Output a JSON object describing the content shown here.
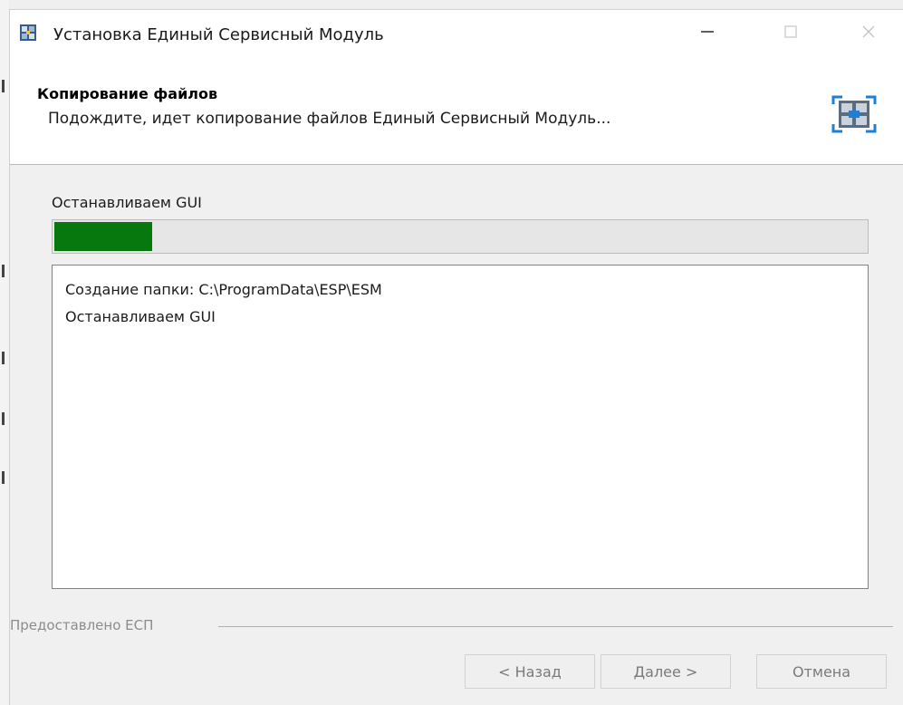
{
  "window": {
    "title": "Установка Единый Сервисный Модуль",
    "app_icon": "installer-app-icon",
    "controls": [
      "minimize-icon",
      "maximize-icon",
      "close-icon"
    ]
  },
  "header": {
    "title": "Копирование файлов",
    "subtitle": "Подождите, идет копирование файлов Единый Сервисный Модуль...",
    "icon": "esm-brand-icon"
  },
  "progress": {
    "status_label": "Останавливаем GUI",
    "value_percent": 12,
    "fill_color": "#06780d"
  },
  "log": {
    "lines": [
      "Создание папки: C:\\ProgramData\\ESP\\ESM",
      "Останавливаем GUI"
    ]
  },
  "footer": {
    "provided_by": "Предоставлено ЕСП",
    "back_label": "< Назад",
    "next_label": "Далее >",
    "cancel_label": "Отмена"
  }
}
